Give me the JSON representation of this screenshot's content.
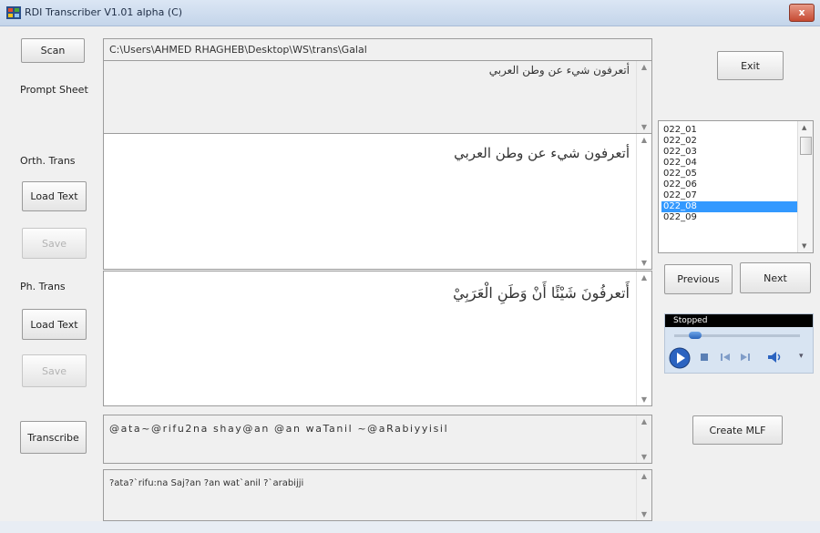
{
  "window": {
    "title": "RDI Transcriber V1.01 alpha (C)",
    "close_glyph": "x",
    "icon": "app-icon"
  },
  "left_panel": {
    "scan_label": "Scan",
    "prompt_sheet_label": "Prompt Sheet",
    "orth_trans_label": "Orth. Trans",
    "load_text_label_1": "Load Text",
    "save_label_1": "Save",
    "ph_trans_label": "Ph. Trans",
    "load_text_label_2": "Load Text",
    "save_label_2": "Save",
    "transcribe_label": "Transcribe"
  },
  "main": {
    "path_value": "C:\\Users\\AHMED RHAGHEB\\Desktop\\WS\\trans\\Galal",
    "prompt_text": "أتعرفون شيء عن وطن العربي",
    "orth_text": "أتعرفون شيء عن وطن العربي",
    "ph_text": "أَتعرفُونَ شَيْئًا أَنْ وَطَنِ الْعَرَبِيْ",
    "transcription_text": "@ata~@rifu2na shay@an @an waTanil ~@aRabiyyisil",
    "ipa_text": "?ata?`rifu:na Saj?an ?an wat`anil ?`arabijji"
  },
  "right_panel": {
    "exit_label": "Exit",
    "file_list": [
      "022_01",
      "022_02",
      "022_03",
      "022_04",
      "022_05",
      "022_06",
      "022_07",
      "022_08",
      "022_09"
    ],
    "selected_index": 7,
    "previous_label": "Previous",
    "next_label": "Next",
    "player_status": "Stopped",
    "create_mlf_label": "Create MLF"
  },
  "colors": {
    "selection": "#3399ff",
    "titlebar": "#c4d5ea",
    "close_button": "#c64a32"
  }
}
